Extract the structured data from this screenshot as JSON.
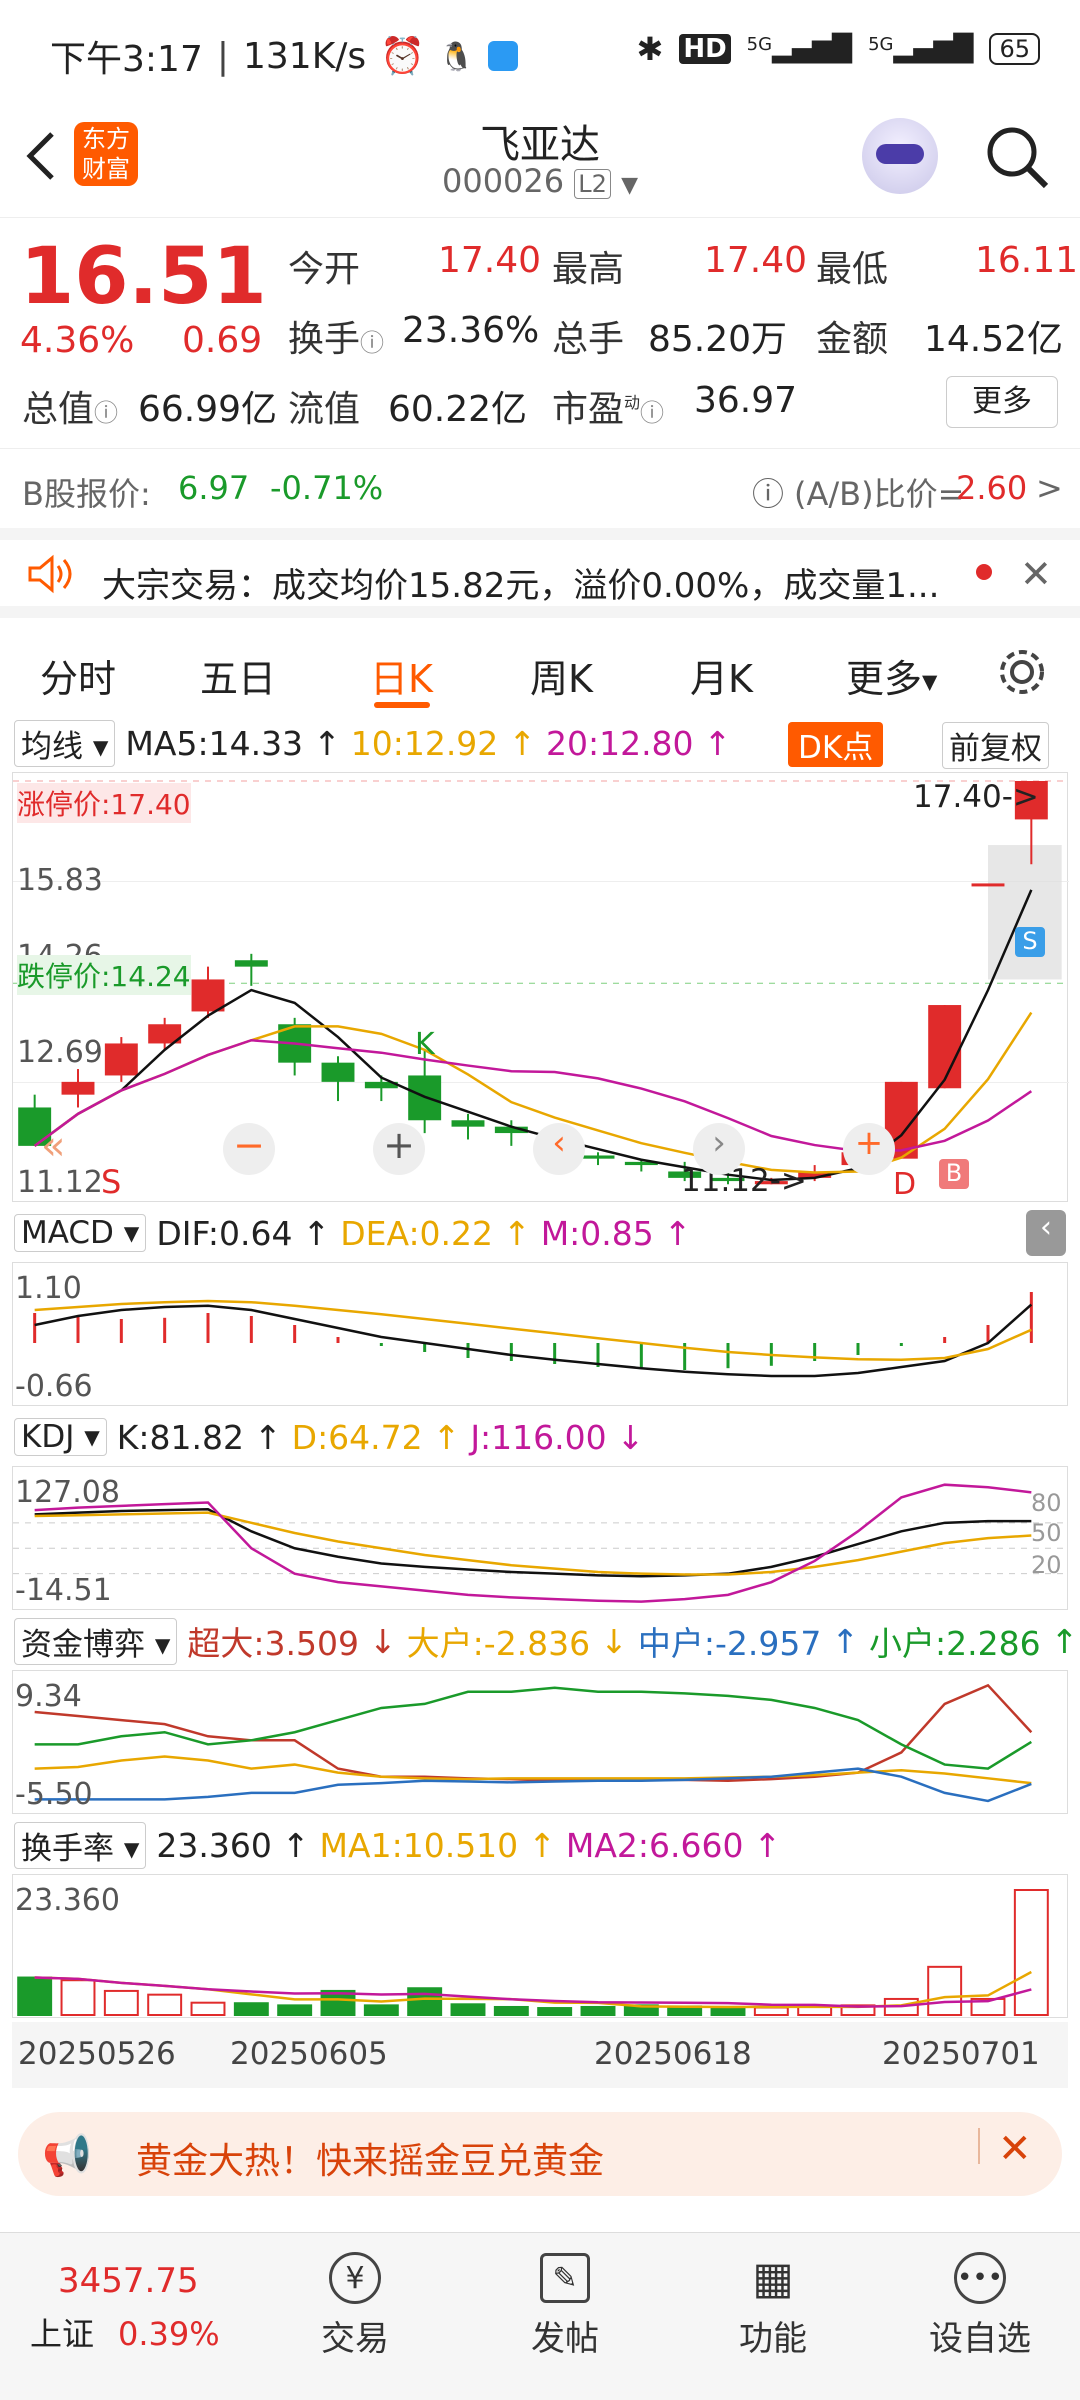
{
  "status": {
    "time": "下午3:17",
    "speed": "131K/s",
    "battery": "65",
    "hd": "HD",
    "sig1": "5G",
    "sig2": "5G"
  },
  "nav": {
    "logo": "东方财富",
    "title": "飞亚达",
    "code": "000026",
    "level": "L2"
  },
  "quote": {
    "price": "16.51",
    "pct": "4.36%",
    "chg": "0.69",
    "open_l": "今开",
    "open": "17.40",
    "high_l": "最高",
    "high": "17.40",
    "low_l": "最低",
    "low": "16.11",
    "turn_l": "换手",
    "turn": "23.36%",
    "vol_l": "总手",
    "vol": "85.20万",
    "amt_l": "金额",
    "amt": "14.52亿",
    "mcap_l": "总值",
    "mcap": "66.99亿",
    "float_l": "流值",
    "float": "60.22亿",
    "pe_l": "市盈",
    "pe_sup": "动",
    "pe": "36.97",
    "more": "更多"
  },
  "bshare": {
    "label": "B股报价:",
    "price": "6.97",
    "pct": "-0.71%",
    "ratio_l": "(A/B)比价=",
    "ratio": "2.60"
  },
  "notice": {
    "text": "大宗交易：成交均价15.82元，溢价0.00%，成交量1..."
  },
  "tabs": [
    "分时",
    "五日",
    "日K",
    "周K",
    "月K",
    "更多"
  ],
  "active_tab": 2,
  "ma": {
    "sel": "均线",
    "ma5": "MA5:14.33",
    "ma10": "10:12.92",
    "ma20": "20:12.80",
    "dk": "DK点",
    "adj": "前复权"
  },
  "main": {
    "limitup": "涨停价:17.40",
    "limitdown": "跌停价:14.24",
    "y1": "15.83",
    "y2": "14.26",
    "y3": "12.69",
    "y4": "11.12",
    "hi": "17.40",
    "lo": "11.12",
    "s": "S",
    "b": "B",
    "k": "K",
    "d": "D"
  },
  "macd": {
    "sel": "MACD",
    "dif": "DIF:0.64",
    "dea": "DEA:0.22",
    "m": "M:0.85",
    "ytop": "1.10",
    "ybot": "-0.66"
  },
  "kdj": {
    "sel": "KDJ",
    "k": "K:81.82",
    "d": "D:64.72",
    "j": "J:116.00",
    "ytop": "127.08",
    "ybot": "-14.51",
    "l80": "80",
    "l50": "50",
    "l20": "20"
  },
  "fund": {
    "sel": "资金博弈",
    "super": "超大:3.509",
    "big": "大户:-2.836",
    "mid": "中户:-2.957",
    "small": "小户:2.286",
    "ytop": "9.34",
    "ybot": "-5.50"
  },
  "turnover": {
    "sel": "换手率",
    "val": "23.360",
    "ma1": "MA1:10.510",
    "ma2": "MA2:6.660",
    "ytop": "23.360"
  },
  "dates": [
    "20250526",
    "20250605",
    "20250618",
    "20250701"
  ],
  "ad": {
    "text": "黄金大热！快来摇金豆兑黄金"
  },
  "bottom": {
    "idx": "3457.75",
    "idx_name": "上证",
    "idx_pct": "0.39%",
    "items": [
      "交易",
      "发帖",
      "功能",
      "设自选"
    ]
  },
  "colors": {
    "up": "#e02b2b",
    "down": "#1a9a2a",
    "accent": "#ff5a00"
  },
  "chart_data": {
    "type": "candlestick",
    "candles": [
      [
        12.3,
        11.7,
        12.5,
        11.7
      ],
      [
        12.5,
        12.7,
        12.9,
        12.3
      ],
      [
        12.8,
        13.3,
        13.4,
        12.7
      ],
      [
        13.3,
        13.6,
        13.7,
        13.2
      ],
      [
        13.8,
        14.3,
        14.5,
        13.7
      ],
      [
        14.6,
        14.5,
        14.7,
        14.2
      ],
      [
        13.6,
        13.0,
        13.7,
        12.8
      ],
      [
        13.0,
        12.7,
        13.1,
        12.4
      ],
      [
        12.7,
        12.6,
        12.8,
        12.4
      ],
      [
        12.8,
        12.1,
        13.2,
        11.9
      ],
      [
        12.1,
        12.0,
        12.2,
        11.8
      ],
      [
        12.0,
        11.9,
        12.1,
        11.7
      ],
      [
        11.9,
        11.55,
        11.95,
        11.5
      ],
      [
        11.55,
        11.5,
        11.6,
        11.4
      ],
      [
        11.45,
        11.4,
        11.5,
        11.3
      ],
      [
        11.3,
        11.2,
        11.45,
        11.15
      ],
      [
        11.2,
        11.15,
        11.3,
        11.1
      ],
      [
        11.1,
        11.15,
        11.2,
        11.1
      ],
      [
        11.2,
        11.3,
        11.4,
        11.15
      ],
      [
        11.4,
        11.6,
        11.8,
        11.3
      ],
      [
        11.5,
        12.7,
        12.7,
        11.5
      ],
      [
        12.6,
        13.9,
        13.9,
        12.6
      ],
      [
        15.8,
        15.8,
        15.8,
        15.8
      ],
      [
        16.8,
        17.4,
        17.4,
        16.1
      ]
    ]
  }
}
